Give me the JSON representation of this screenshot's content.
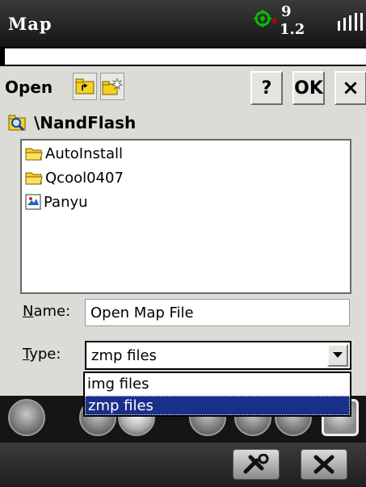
{
  "app": {
    "title": "Map"
  },
  "status": {
    "gps_icon": "gps-crosshair-icon",
    "sat_indicator": "s",
    "top_number": "9",
    "bottom_number": "1.2",
    "signal_icon": "signal-bars-icon"
  },
  "dialog": {
    "title": "Open",
    "buttons": {
      "help": "?",
      "ok": "OK",
      "close": "×"
    },
    "path": "\\NandFlash",
    "files": [
      {
        "name": "AutoInstall",
        "icon": "folder-icon"
      },
      {
        "name": "Qcool0407",
        "icon": "folder-icon"
      },
      {
        "name": "Panyu",
        "icon": "map-file-icon"
      }
    ],
    "name_label_first": "N",
    "name_label_rest": "ame:",
    "name_value": "Open Map File",
    "type_label_first": "T",
    "type_label_rest": "ype:",
    "type_value": "zmp files",
    "type_options": [
      "img files",
      "zmp files"
    ],
    "type_selected": "zmp files"
  },
  "colors": {
    "dialog_bg": "#dcdcd6",
    "selection": "#1a2f8a",
    "gps": "#00b000"
  }
}
